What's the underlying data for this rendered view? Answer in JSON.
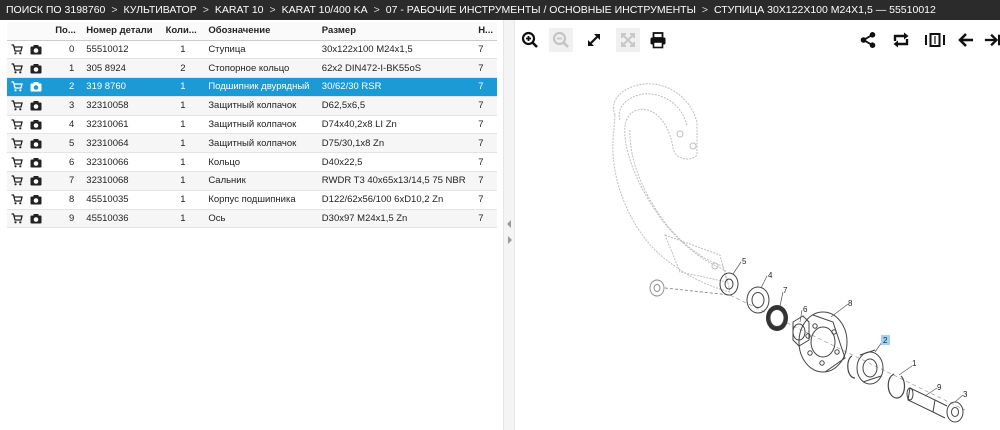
{
  "breadcrumb": [
    "ПОИСК ПО 3198760",
    "КУЛЬТИВАТОР",
    "KARAT 10",
    "KARAT 10/400 KA",
    "07 - РАБОЧИЕ ИНСТРУМЕНТЫ / ОСНОВНЫЕ ИНСТРУМЕНТЫ",
    "СТУПИЦА 30X122X100 M24X1,5 — 55510012"
  ],
  "breadcrumb_separator": ">",
  "table": {
    "headers": [
      "",
      "По...",
      "Номер детали",
      "Коли...",
      "Обозначение",
      "Размер",
      "Н..."
    ],
    "rows": [
      {
        "pos": "0",
        "part": "55510012",
        "qty": "1",
        "name": "Ступица",
        "size": "30x122x100 M24x1,5",
        "n": "7"
      },
      {
        "pos": "1",
        "part": "305 8924",
        "qty": "2",
        "name": "Стопорное кольцо",
        "size": "62x2 DIN472-I-BK55oS",
        "n": "7"
      },
      {
        "pos": "2",
        "part": "319 8760",
        "qty": "1",
        "name": "Подшипник двурядный",
        "size": "30/62/30 RSR",
        "n": "7",
        "selected": true
      },
      {
        "pos": "3",
        "part": "32310058",
        "qty": "1",
        "name": "Защитный колпачок",
        "size": "D62,5x6,5",
        "n": "7"
      },
      {
        "pos": "4",
        "part": "32310061",
        "qty": "1",
        "name": "Защитный колпачок",
        "size": "D74x40,2x8 LI Zn",
        "n": "7"
      },
      {
        "pos": "5",
        "part": "32310064",
        "qty": "1",
        "name": "Защитный колпачок",
        "size": "D75/30,1x8 Zn",
        "n": "7"
      },
      {
        "pos": "6",
        "part": "32310066",
        "qty": "1",
        "name": "Кольцо",
        "size": "D40x22,5",
        "n": "7"
      },
      {
        "pos": "7",
        "part": "32310068",
        "qty": "1",
        "name": "Сальник",
        "size": "RWDR T3 40x65x13/14,5 75 NBR",
        "n": "7"
      },
      {
        "pos": "8",
        "part": "45510035",
        "qty": "1",
        "name": "Корпус подшипника",
        "size": "D122/62x56/100 6xD10,2 Zn",
        "n": "7"
      },
      {
        "pos": "9",
        "part": "45510036",
        "qty": "1",
        "name": "Ось",
        "size": "D30x97 M24x1,5 Zn",
        "n": "7"
      }
    ]
  },
  "toolbar": {
    "left_icons": [
      "zoom-in-icon",
      "zoom-out-icon",
      "expand-icon",
      "fit-icon",
      "print-icon"
    ],
    "right_icons": [
      "share-icon",
      "rotate-icon",
      "flip-icon",
      "arrow-left-icon",
      "arrow-right-icon"
    ]
  },
  "callouts": [
    "5",
    "4",
    "7",
    "6",
    "8",
    "2",
    "1",
    "9",
    "3"
  ],
  "highlight_callout": "2",
  "colors": {
    "topbar_bg": "#2b2b2b",
    "selected_row": "#1b9ad6",
    "highlight_callout_bg": "#9fd3f0"
  }
}
